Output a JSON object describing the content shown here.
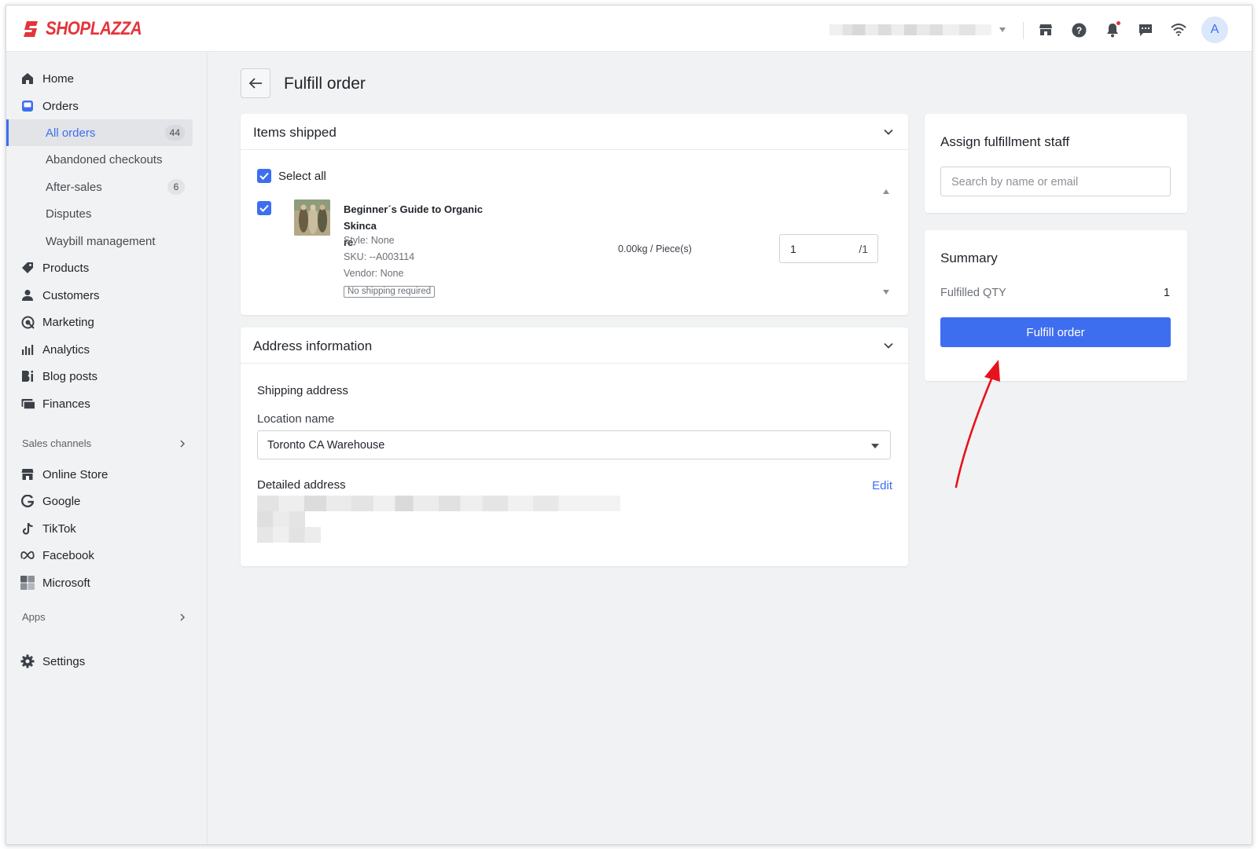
{
  "brand": {
    "name": "SHOPLAZZA",
    "color": "#e4343b"
  },
  "header": {
    "icons": [
      "store-icon",
      "help-icon",
      "bell-icon",
      "chat-icon",
      "wifi-icon"
    ],
    "avatar_initial": "A"
  },
  "sidebar": {
    "items": [
      {
        "label": "Home",
        "icon": "home-icon"
      },
      {
        "label": "Orders",
        "icon": "orders-icon"
      },
      {
        "label": "All orders",
        "count": "44",
        "active": true
      },
      {
        "label": "Abandoned checkouts"
      },
      {
        "label": "After-sales",
        "count": "6"
      },
      {
        "label": "Disputes"
      },
      {
        "label": "Waybill management"
      },
      {
        "label": "Products",
        "icon": "tag-icon"
      },
      {
        "label": "Customers",
        "icon": "person-icon"
      },
      {
        "label": "Marketing",
        "icon": "marketing-icon"
      },
      {
        "label": "Analytics",
        "icon": "bar-chart-icon"
      },
      {
        "label": "Blog posts",
        "icon": "blog-icon"
      },
      {
        "label": "Finances",
        "icon": "finance-icon"
      }
    ],
    "sales_channels_label": "Sales channels",
    "channels": [
      {
        "label": "Online Store",
        "icon": "store-icon"
      },
      {
        "label": "Google",
        "icon": "google-icon"
      },
      {
        "label": "TikTok",
        "icon": "tiktok-icon"
      },
      {
        "label": "Facebook",
        "icon": "meta-icon"
      },
      {
        "label": "Microsoft",
        "icon": "microsoft-icon"
      }
    ],
    "apps_label": "Apps",
    "settings_label": "Settings"
  },
  "page": {
    "title": "Fulfill order"
  },
  "items_shipped": {
    "title": "Items shipped",
    "select_all_label": "Select all",
    "product": {
      "title_line1": "Beginner´s Guide to Organic Skinca",
      "title_line2": "re",
      "style": "Style: None",
      "sku": "SKU: --A003114",
      "vendor": "Vendor: None",
      "shipping_tag": "No shipping required",
      "weight": "0.00kg / Piece(s)",
      "qty": "1",
      "qty_max": "/1"
    }
  },
  "address": {
    "title": "Address information",
    "shipping_address_label": "Shipping address",
    "location_name_label": "Location name",
    "location_value": "Toronto CA Warehouse",
    "detailed_address_label": "Detailed address",
    "edit_label": "Edit"
  },
  "staff": {
    "title": "Assign fulfillment staff",
    "search_placeholder": "Search by name or email"
  },
  "summary": {
    "title": "Summary",
    "fulfilled_qty_label": "Fulfilled QTY",
    "fulfilled_qty_value": "1",
    "button_label": "Fulfill order"
  },
  "colors": {
    "accent": "#3e6ef0",
    "annotation_arrow": "#e8121c"
  }
}
